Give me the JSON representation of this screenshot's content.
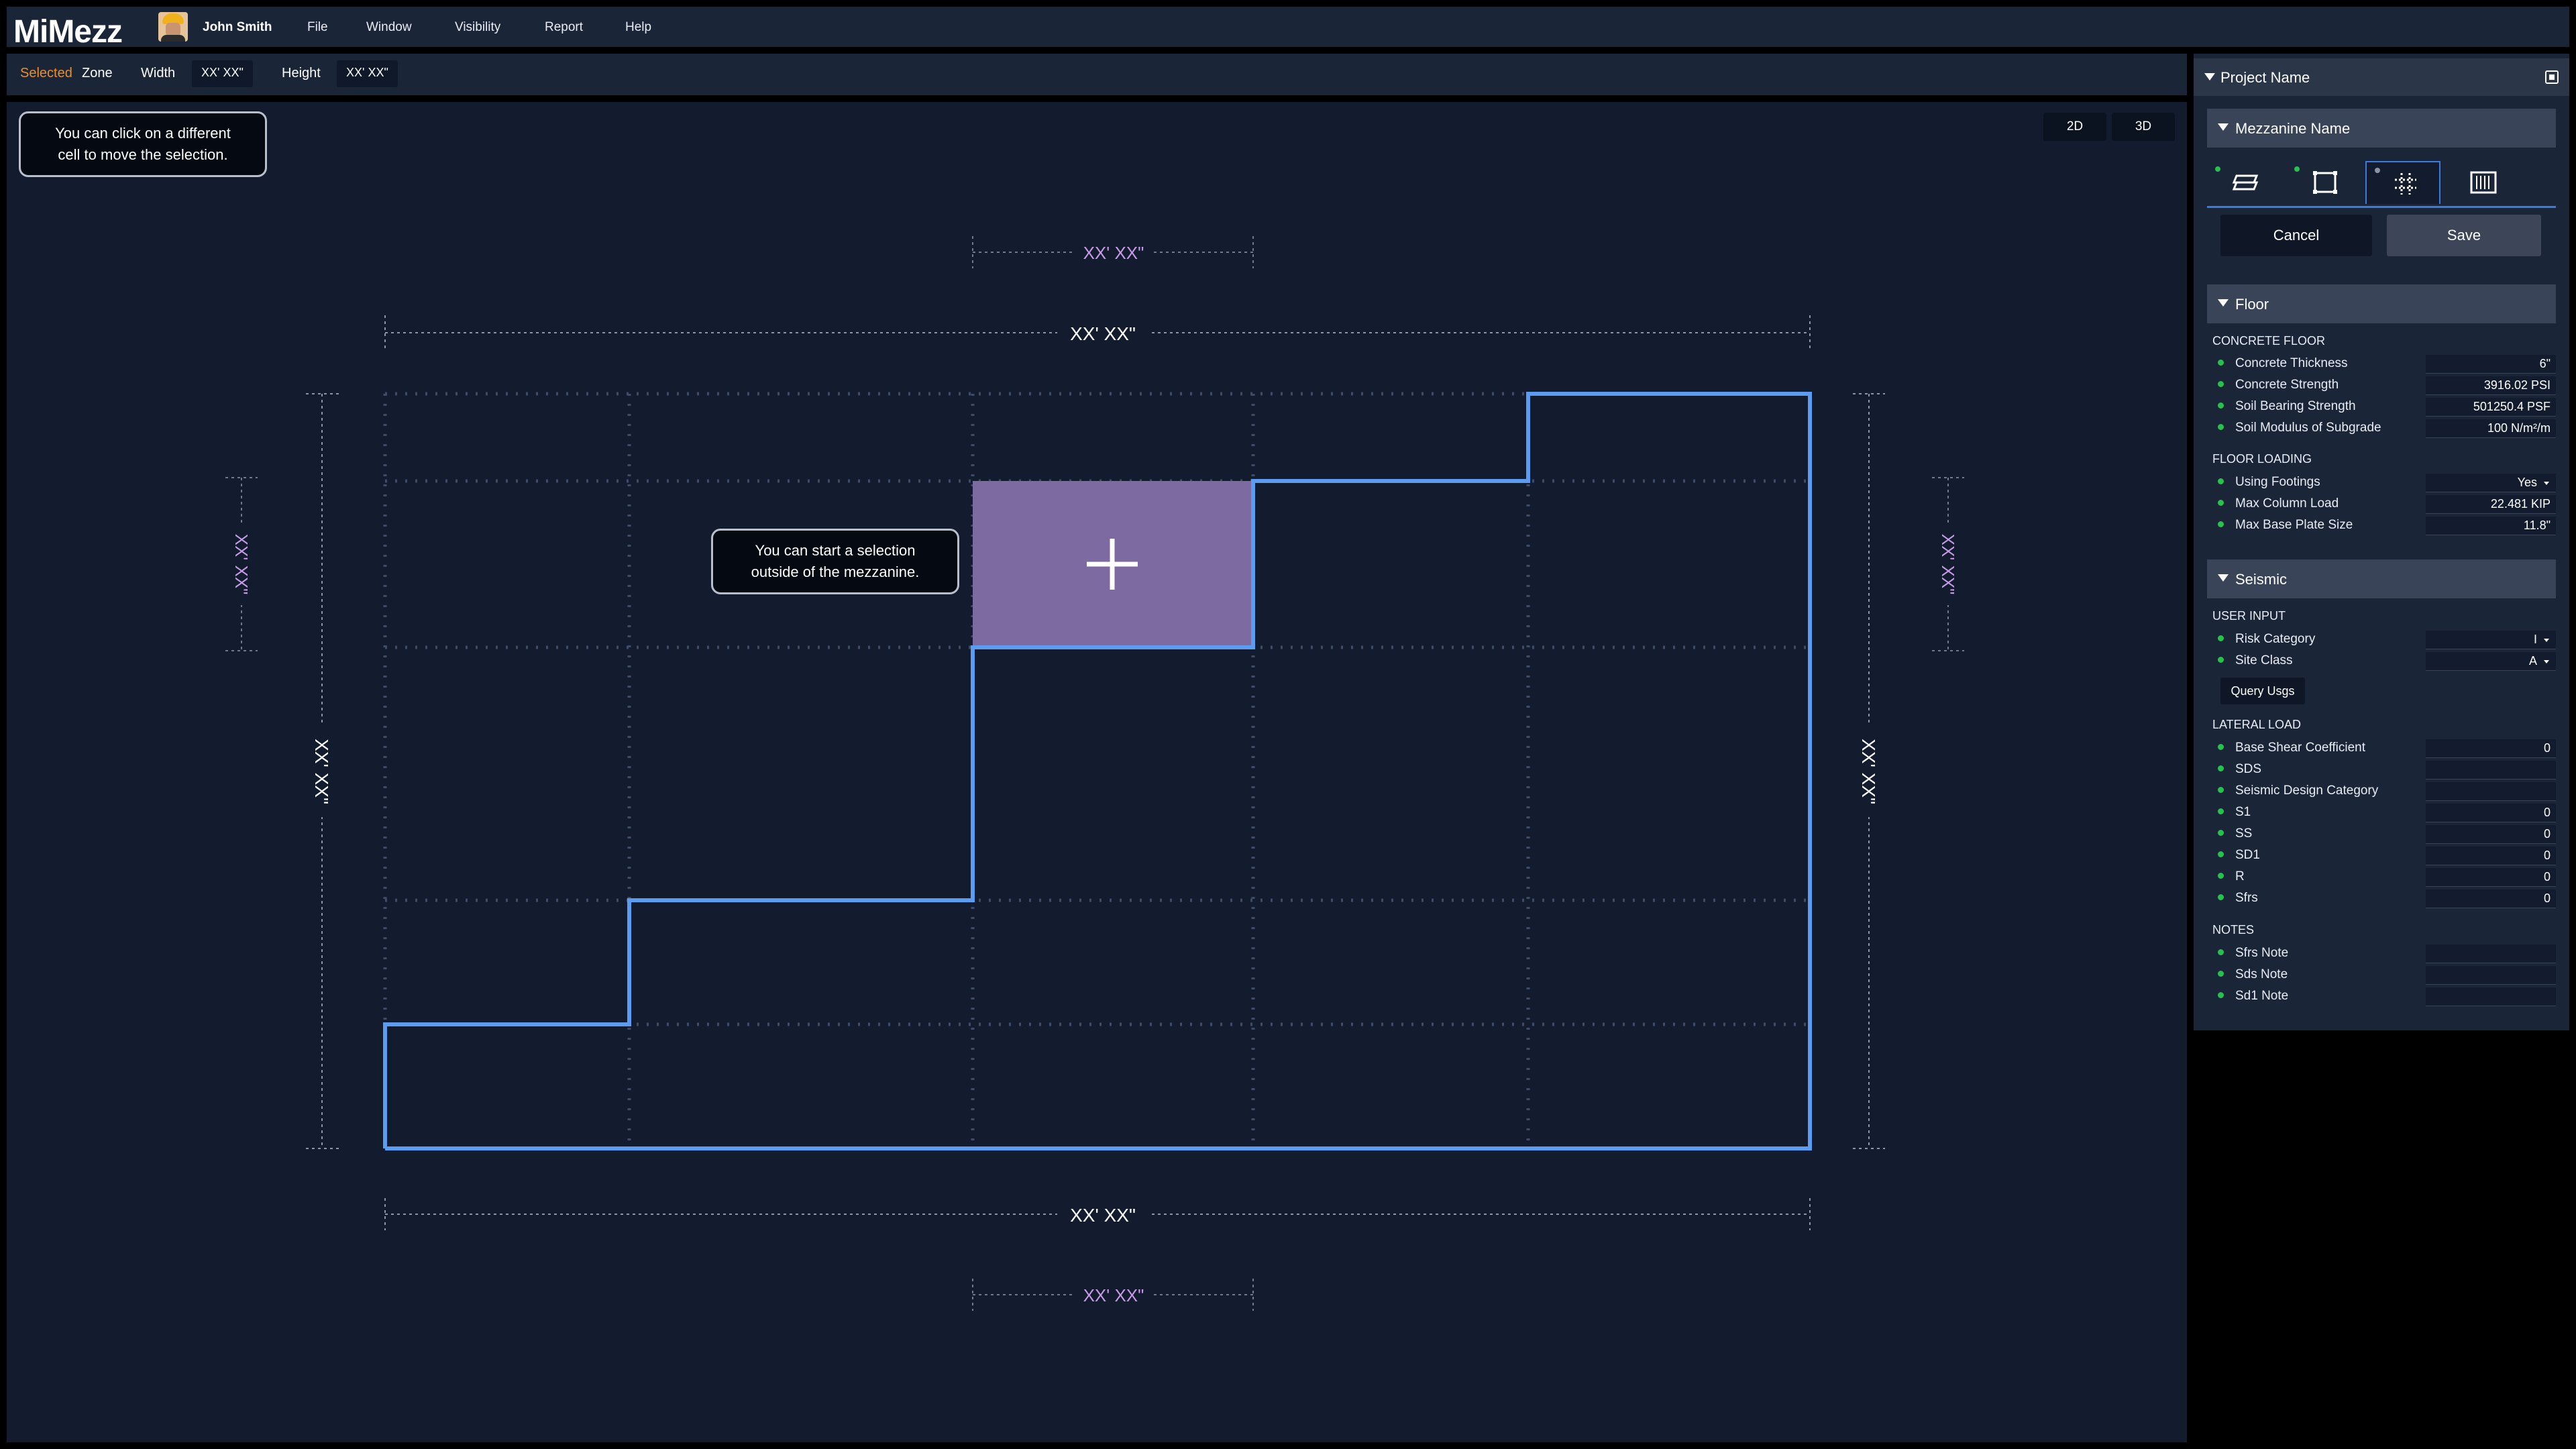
{
  "app": {
    "title": "MiMezz"
  },
  "user": {
    "name": "John Smith"
  },
  "menu": [
    "File",
    "Window",
    "Visibility",
    "Report",
    "Help"
  ],
  "toolbar": {
    "selected_label": "Selected",
    "selected_value": "Zone",
    "width_label": "Width",
    "width_value": "XX' XX\"",
    "height_label": "Height",
    "height_value": "XX' XX\""
  },
  "view_toggle": {
    "two_d": "2D",
    "three_d": "3D"
  },
  "tooltips": {
    "move": [
      "You can click on a different",
      "cell to move the selection."
    ],
    "start": [
      "You can start a selection",
      "outside of the mezzanine."
    ]
  },
  "dimensions": {
    "selection_top": "XX' XX\"",
    "overall_top": "XX' XX\"",
    "overall_bottom": "XX' XX\"",
    "selection_bottom": "XX' XX\"",
    "overall_left": "XX' XX\"",
    "overall_right": "XX' XX\"",
    "selection_left": "XX' XX\"",
    "selection_right": "XX' XX\""
  },
  "colors": {
    "outline": "#5b9cf0",
    "selection_fill": "#7c6aa0",
    "selection_label": "#c89be8",
    "grid": "#3e4c68",
    "status_ok": "#27c24c"
  },
  "panel": {
    "project": "Project Name",
    "mezzanine": "Mezzanine Name",
    "tabs": [
      {
        "icon": "deck-layers-icon",
        "dot": "green"
      },
      {
        "icon": "frame-square-icon",
        "dot": "green"
      },
      {
        "icon": "grid-icon",
        "dot": "grey",
        "active": true
      },
      {
        "icon": "railing-icon",
        "dot": "none"
      }
    ],
    "cancel": "Cancel",
    "save": "Save",
    "floor": {
      "title": "Floor",
      "concrete_label": "CONCRETE FLOOR",
      "concrete": [
        {
          "name": "Concrete Thickness",
          "value": "6\""
        },
        {
          "name": "Concrete Strength",
          "value": "3916.02 PSI"
        },
        {
          "name": "Soil Bearing Strength",
          "value": "501250.4 PSF"
        },
        {
          "name": "Soil Modulus of Subgrade",
          "value": "100 N/m²/m"
        }
      ],
      "loading_label": "FLOOR LOADING",
      "loading": [
        {
          "name": "Using Footings",
          "value": "Yes",
          "dropdown": true
        },
        {
          "name": "Max Column Load",
          "value": "22.481 KIP"
        },
        {
          "name": "Max Base Plate Size",
          "value": "11.8\""
        }
      ]
    },
    "seismic": {
      "title": "Seismic",
      "user_input_label": "USER INPUT",
      "user_input": [
        {
          "name": "Risk Category",
          "value": "I",
          "dropdown": true
        },
        {
          "name": "Site Class",
          "value": "A",
          "dropdown": true
        }
      ],
      "query_button": "Query Usgs",
      "lateral_label": "LATERAL LOAD",
      "lateral": [
        {
          "name": "Base Shear Coefficient",
          "value": "0"
        },
        {
          "name": "SDS",
          "value": ""
        },
        {
          "name": "Seismic Design Category",
          "value": ""
        },
        {
          "name": "S1",
          "value": "0"
        },
        {
          "name": "SS",
          "value": "0"
        },
        {
          "name": "SD1",
          "value": "0"
        },
        {
          "name": "R",
          "value": "0"
        },
        {
          "name": "Sfrs",
          "value": "0"
        }
      ],
      "notes_label": "NOTES",
      "notes": [
        {
          "name": "Sfrs Note",
          "value": ""
        },
        {
          "name": "Sds Note",
          "value": ""
        },
        {
          "name": "Sd1 Note",
          "value": ""
        }
      ]
    }
  }
}
